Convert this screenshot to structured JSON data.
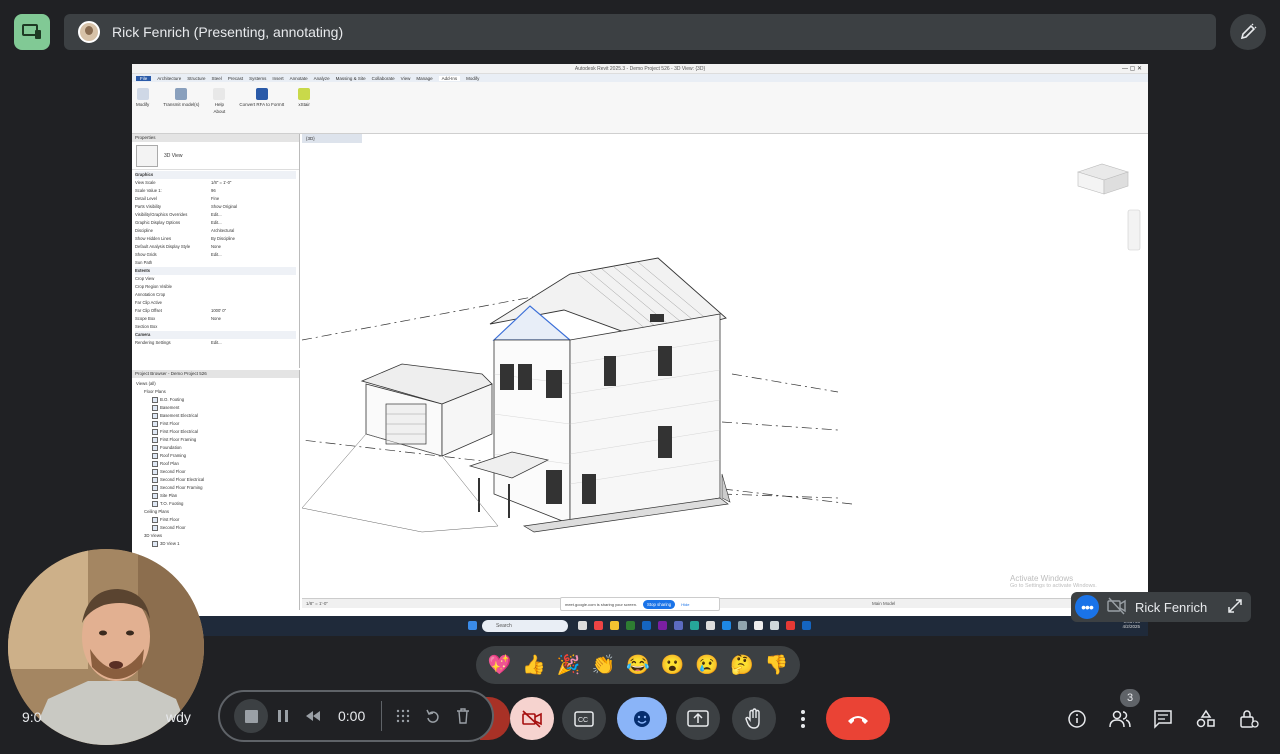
{
  "header": {
    "presenter_label": "Rick Fenrich (Presenting, annotating)"
  },
  "shared_screen": {
    "window_title": "Autodesk Revit 2025.3 - Demo Project 526 - 3D View: {3D}",
    "ribbon_tabs": [
      "File",
      "Architecture",
      "Structure",
      "Steel",
      "Precast",
      "Systems",
      "Insert",
      "Annotate",
      "Analyze",
      "Massing & Site",
      "Collaborate",
      "View",
      "Manage",
      "Add-Ins",
      "Modify"
    ],
    "active_ribbon_tab": "Add-Ins",
    "ribbon_items": [
      "Modify",
      "Transmit model(s)",
      "Help",
      "About",
      "Convert RFA to FormIt",
      "xStair"
    ],
    "properties_title": "Properties",
    "properties_type": "3D View",
    "properties_rows": [
      {
        "k": "Graphics",
        "v": "",
        "group": true
      },
      {
        "k": "View Scale",
        "v": "1/8\" = 1'-0\""
      },
      {
        "k": "Scale Value 1:",
        "v": "96"
      },
      {
        "k": "Detail Level",
        "v": "Fine"
      },
      {
        "k": "Parts Visibility",
        "v": "Show Original"
      },
      {
        "k": "Visibility/Graphics Overrides",
        "v": "Edit..."
      },
      {
        "k": "Graphic Display Options",
        "v": "Edit..."
      },
      {
        "k": "Discipline",
        "v": "Architectural"
      },
      {
        "k": "Show Hidden Lines",
        "v": "By Discipline"
      },
      {
        "k": "Default Analysis Display Style",
        "v": "None"
      },
      {
        "k": "Show Grids",
        "v": "Edit..."
      },
      {
        "k": "Sun Path",
        "v": ""
      },
      {
        "k": "Extents",
        "v": "",
        "group": true
      },
      {
        "k": "Crop View",
        "v": ""
      },
      {
        "k": "Crop Region Visible",
        "v": ""
      },
      {
        "k": "Annotation Crop",
        "v": ""
      },
      {
        "k": "Far Clip Active",
        "v": ""
      },
      {
        "k": "Far Clip Offset",
        "v": "1000' 0\""
      },
      {
        "k": "Scope Box",
        "v": "None"
      },
      {
        "k": "Section Box",
        "v": ""
      },
      {
        "k": "Camera",
        "v": "",
        "group": true
      },
      {
        "k": "Rendering Settings",
        "v": "Edit..."
      }
    ],
    "browser_title": "Project Browser - Demo Project 526",
    "browser_tree": [
      {
        "t": "Views (all)",
        "lvl": 1
      },
      {
        "t": "Floor Plans",
        "lvl": 2
      },
      {
        "t": "B.O. Footing",
        "lvl": 3
      },
      {
        "t": "Basement",
        "lvl": 3
      },
      {
        "t": "Basement Electrical",
        "lvl": 3
      },
      {
        "t": "First Floor",
        "lvl": 3
      },
      {
        "t": "First Floor Electrical",
        "lvl": 3
      },
      {
        "t": "First Floor Framing",
        "lvl": 3
      },
      {
        "t": "Foundation",
        "lvl": 3
      },
      {
        "t": "Roof Framing",
        "lvl": 3
      },
      {
        "t": "Roof Plan",
        "lvl": 3
      },
      {
        "t": "Second Floor",
        "lvl": 3
      },
      {
        "t": "Second Floor Electrical",
        "lvl": 3
      },
      {
        "t": "Second Floor Framing",
        "lvl": 3
      },
      {
        "t": "Site Plan",
        "lvl": 3
      },
      {
        "t": "T.O. Footing",
        "lvl": 3
      },
      {
        "t": "Ceiling Plans",
        "lvl": 2
      },
      {
        "t": "First Floor",
        "lvl": 3
      },
      {
        "t": "Second Floor",
        "lvl": 3
      },
      {
        "t": "3D Views",
        "lvl": 2
      },
      {
        "t": "3D View 1",
        "lvl": 3
      }
    ],
    "view_tab": "{3D}",
    "watermark_title": "Activate Windows",
    "watermark_sub": "Go to Settings to activate Windows.",
    "status_scale": "1/8\" = 1'-0\"",
    "share_notice": "meet.google.com is sharing your screen.",
    "stop_sharing": "Stop sharing",
    "hide": "Hide",
    "taskbar_search": "Search",
    "clock_time": "9:06 AM",
    "clock_date": "4/2/2025",
    "model_label": "Main Model"
  },
  "tile": {
    "name": "Rick Fenrich"
  },
  "reactions": [
    "💖",
    "👍",
    "🎉",
    "👏",
    "😂",
    "😮",
    "😢",
    "🤔",
    "👎"
  ],
  "footer": {
    "time": "9:0",
    "meeting_code": "wdy",
    "recording_time": "0:00",
    "participants_count": "3"
  },
  "colors": {
    "background": "#202124",
    "surface": "#3c4043",
    "accent_blue": "#8ab4f8",
    "hangup_red": "#ea4335",
    "app_badge": "#81c995"
  }
}
